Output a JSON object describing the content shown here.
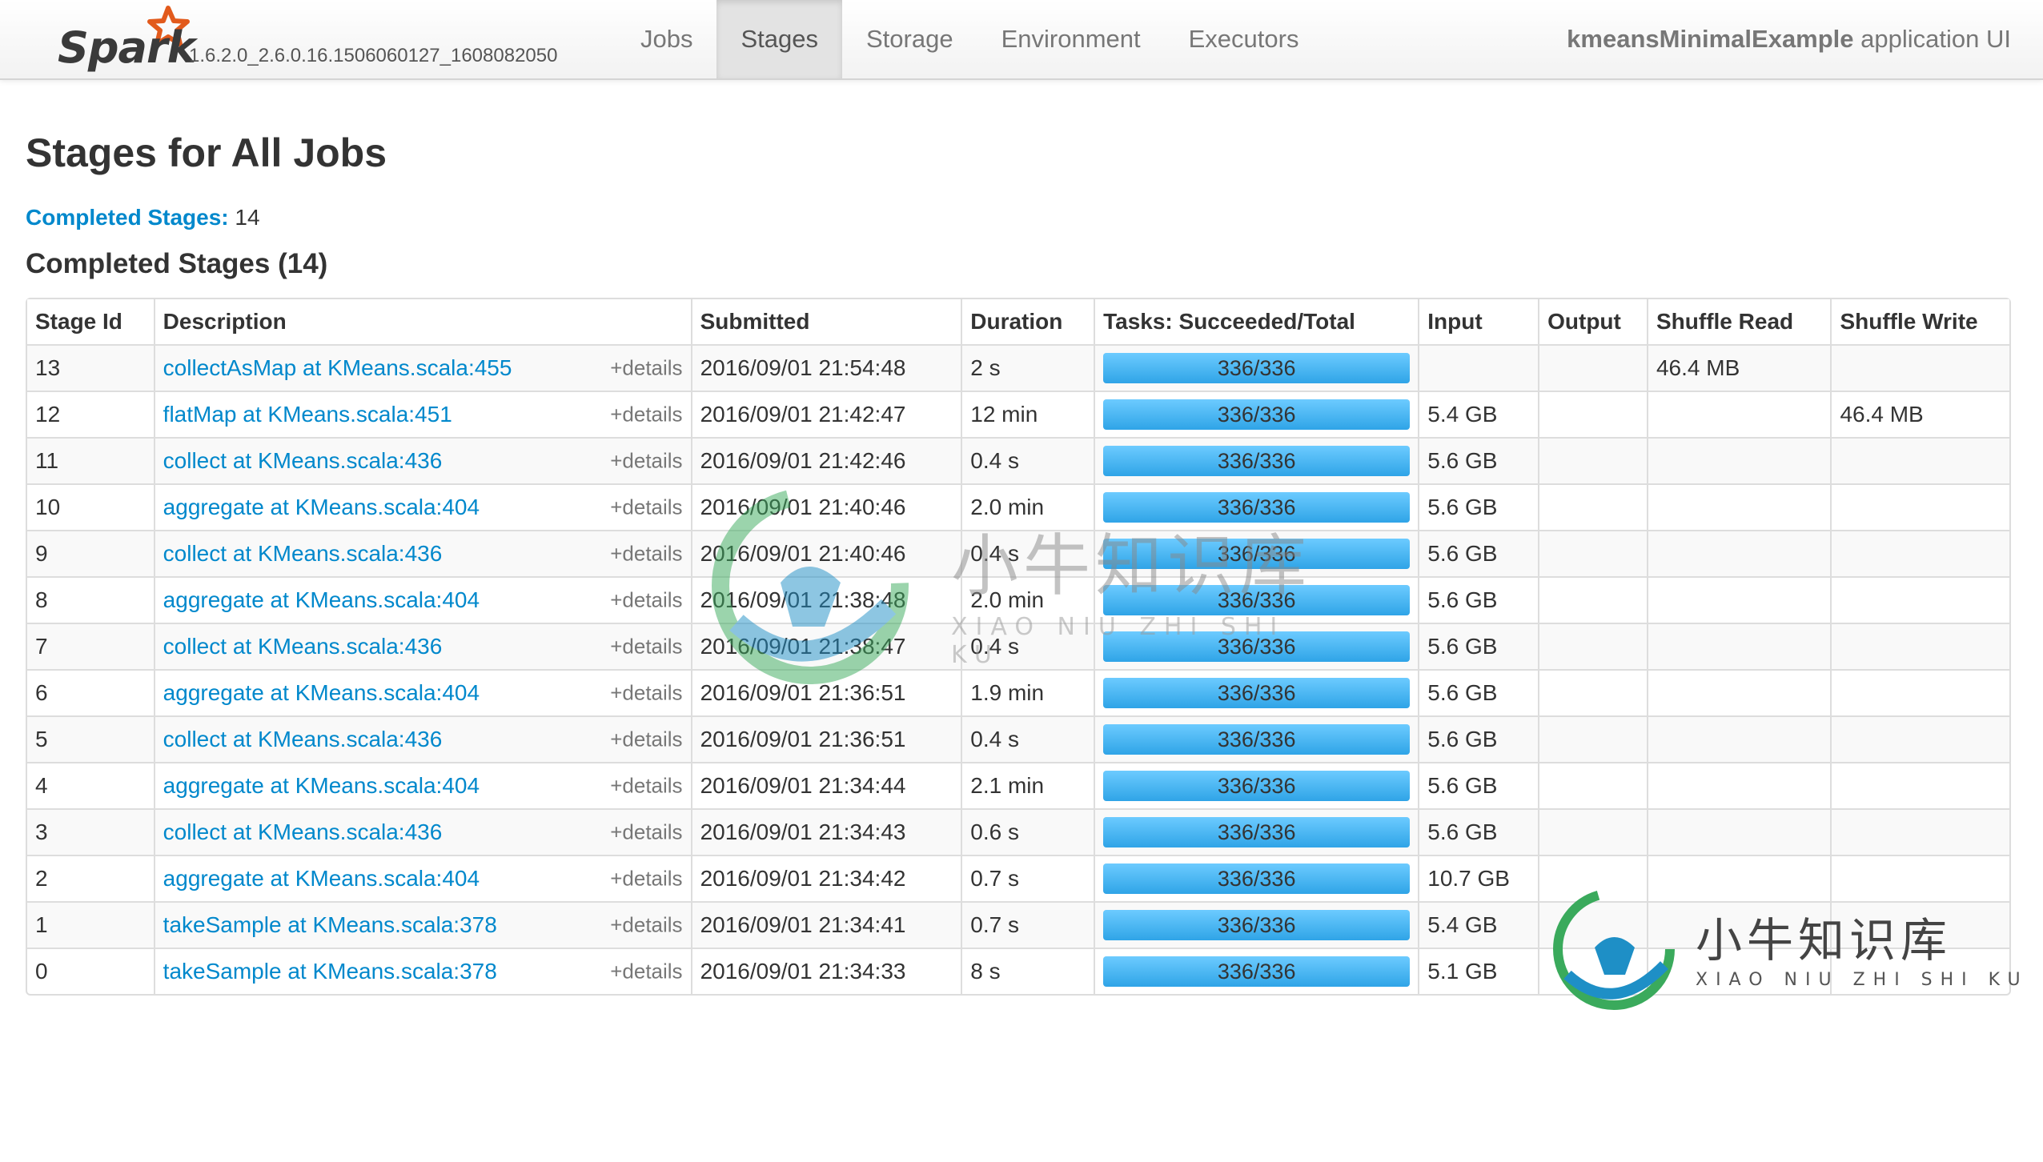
{
  "brand": {
    "name": "Spark",
    "version": "1.6.2.0_2.6.0.16.1506060127_1608082050"
  },
  "nav": {
    "tabs": [
      {
        "label": "Jobs",
        "active": false
      },
      {
        "label": "Stages",
        "active": true
      },
      {
        "label": "Storage",
        "active": false
      },
      {
        "label": "Environment",
        "active": false
      },
      {
        "label": "Executors",
        "active": false
      }
    ],
    "app_name": "kmeansMinimalExample",
    "app_suffix": " application UI"
  },
  "page": {
    "title": "Stages for All Jobs",
    "summary_link": "Completed Stages:",
    "summary_count": " 14",
    "section_title": "Completed Stages (14)"
  },
  "table": {
    "headers": [
      "Stage Id",
      "Description",
      "Submitted",
      "Duration",
      "Tasks: Succeeded/Total",
      "Input",
      "Output",
      "Shuffle Read",
      "Shuffle Write"
    ],
    "details_label": "+details",
    "rows": [
      {
        "id": "13",
        "desc": "collectAsMap at KMeans.scala:455",
        "submitted": "2016/09/01 21:54:48",
        "duration": "2 s",
        "succeeded": 336,
        "total": 336,
        "tasks": "336/336",
        "input": "",
        "output": "",
        "shuffle_read": "46.4 MB",
        "shuffle_write": ""
      },
      {
        "id": "12",
        "desc": "flatMap at KMeans.scala:451",
        "submitted": "2016/09/01 21:42:47",
        "duration": "12 min",
        "succeeded": 336,
        "total": 336,
        "tasks": "336/336",
        "input": "5.4 GB",
        "output": "",
        "shuffle_read": "",
        "shuffle_write": "46.4 MB"
      },
      {
        "id": "11",
        "desc": "collect at KMeans.scala:436",
        "submitted": "2016/09/01 21:42:46",
        "duration": "0.4 s",
        "succeeded": 336,
        "total": 336,
        "tasks": "336/336",
        "input": "5.6 GB",
        "output": "",
        "shuffle_read": "",
        "shuffle_write": ""
      },
      {
        "id": "10",
        "desc": "aggregate at KMeans.scala:404",
        "submitted": "2016/09/01 21:40:46",
        "duration": "2.0 min",
        "succeeded": 336,
        "total": 336,
        "tasks": "336/336",
        "input": "5.6 GB",
        "output": "",
        "shuffle_read": "",
        "shuffle_write": ""
      },
      {
        "id": "9",
        "desc": "collect at KMeans.scala:436",
        "submitted": "2016/09/01 21:40:46",
        "duration": "0.4 s",
        "succeeded": 336,
        "total": 336,
        "tasks": "336/336",
        "input": "5.6 GB",
        "output": "",
        "shuffle_read": "",
        "shuffle_write": ""
      },
      {
        "id": "8",
        "desc": "aggregate at KMeans.scala:404",
        "submitted": "2016/09/01 21:38:48",
        "duration": "2.0 min",
        "succeeded": 336,
        "total": 336,
        "tasks": "336/336",
        "input": "5.6 GB",
        "output": "",
        "shuffle_read": "",
        "shuffle_write": ""
      },
      {
        "id": "7",
        "desc": "collect at KMeans.scala:436",
        "submitted": "2016/09/01 21:38:47",
        "duration": "0.4 s",
        "succeeded": 336,
        "total": 336,
        "tasks": "336/336",
        "input": "5.6 GB",
        "output": "",
        "shuffle_read": "",
        "shuffle_write": ""
      },
      {
        "id": "6",
        "desc": "aggregate at KMeans.scala:404",
        "submitted": "2016/09/01 21:36:51",
        "duration": "1.9 min",
        "succeeded": 336,
        "total": 336,
        "tasks": "336/336",
        "input": "5.6 GB",
        "output": "",
        "shuffle_read": "",
        "shuffle_write": ""
      },
      {
        "id": "5",
        "desc": "collect at KMeans.scala:436",
        "submitted": "2016/09/01 21:36:51",
        "duration": "0.4 s",
        "succeeded": 336,
        "total": 336,
        "tasks": "336/336",
        "input": "5.6 GB",
        "output": "",
        "shuffle_read": "",
        "shuffle_write": ""
      },
      {
        "id": "4",
        "desc": "aggregate at KMeans.scala:404",
        "submitted": "2016/09/01 21:34:44",
        "duration": "2.1 min",
        "succeeded": 336,
        "total": 336,
        "tasks": "336/336",
        "input": "5.6 GB",
        "output": "",
        "shuffle_read": "",
        "shuffle_write": ""
      },
      {
        "id": "3",
        "desc": "collect at KMeans.scala:436",
        "submitted": "2016/09/01 21:34:43",
        "duration": "0.6 s",
        "succeeded": 336,
        "total": 336,
        "tasks": "336/336",
        "input": "5.6 GB",
        "output": "",
        "shuffle_read": "",
        "shuffle_write": ""
      },
      {
        "id": "2",
        "desc": "aggregate at KMeans.scala:404",
        "submitted": "2016/09/01 21:34:42",
        "duration": "0.7 s",
        "succeeded": 336,
        "total": 336,
        "tasks": "336/336",
        "input": "10.7 GB",
        "output": "",
        "shuffle_read": "",
        "shuffle_write": ""
      },
      {
        "id": "1",
        "desc": "takeSample at KMeans.scala:378",
        "submitted": "2016/09/01 21:34:41",
        "duration": "0.7 s",
        "succeeded": 336,
        "total": 336,
        "tasks": "336/336",
        "input": "5.4 GB",
        "output": "",
        "shuffle_read": "",
        "shuffle_write": ""
      },
      {
        "id": "0",
        "desc": "takeSample at KMeans.scala:378",
        "submitted": "2016/09/01 21:34:33",
        "duration": "8 s",
        "succeeded": 336,
        "total": 336,
        "tasks": "336/336",
        "input": "5.1 GB",
        "output": "",
        "shuffle_read": "",
        "shuffle_write": ""
      }
    ]
  },
  "watermark": {
    "cn": "小牛知识库",
    "en": "XIAO NIU ZHI SHI KU"
  },
  "colors": {
    "link": "#0088cc",
    "progress": "#2fa4e7",
    "watermark_green": "#3aaa5c",
    "watermark_blue": "#1e8fc6",
    "spark_orange": "#e25a1c"
  }
}
